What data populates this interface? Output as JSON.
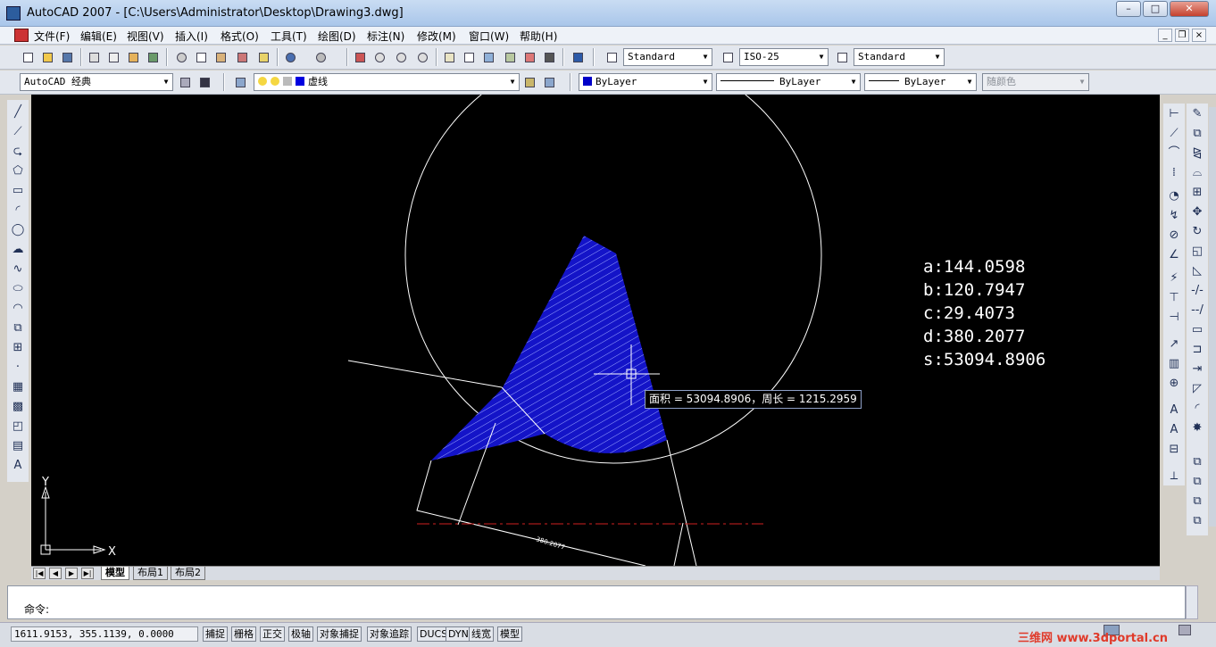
{
  "window": {
    "title": "AutoCAD 2007 - [C:\\Users\\Administrator\\Desktop\\Drawing3.dwg]",
    "minimize": "–",
    "maximize": "□",
    "close": "✕"
  },
  "menu": {
    "items": [
      "文件(F)",
      "编辑(E)",
      "视图(V)",
      "插入(I)",
      "格式(O)",
      "工具(T)",
      "绘图(D)",
      "标注(N)",
      "修改(M)",
      "窗口(W)",
      "帮助(H)"
    ],
    "doc_min": "_",
    "doc_restore": "❐",
    "doc_close": "×"
  },
  "toolbar1": {
    "text_style": "Standard",
    "dim_style": "ISO-25",
    "table_style": "Standard"
  },
  "toolbar2": {
    "workspace": "AutoCAD 经典",
    "layer": "虚线",
    "color": "ByLayer",
    "linetype": "ByLayer",
    "lineweight": "ByLayer",
    "plot_style": "随颜色"
  },
  "drawing": {
    "annotations": [
      "a:144.0598",
      "b:120.7947",
      "c:29.4073",
      "d:380.2077",
      "s:53094.8906"
    ],
    "tooltip": "面积 = 53094.8906，周长 = 1215.2959",
    "ucs_x": "X",
    "ucs_y": "Y",
    "hatch_color": "#1414c8",
    "dimension_label": "380.2077"
  },
  "layout_tabs": [
    "模型",
    "布局1",
    "布局2"
  ],
  "command": {
    "prompt": "命令:"
  },
  "status": {
    "coords": "1611.9153,  355.1139,  0.0000",
    "buttons": [
      "捕捉",
      "栅格",
      "正交",
      "极轴",
      "对象捕捉",
      "对象追踪",
      "DUCS",
      "DYN",
      "线宽",
      "模型"
    ],
    "brand": "三维网 www.3dportal.cn"
  }
}
